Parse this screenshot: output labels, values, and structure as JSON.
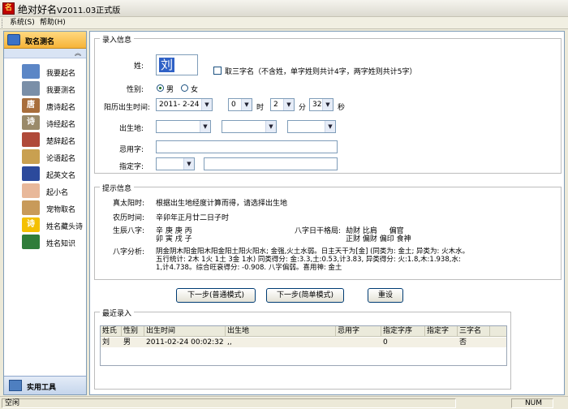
{
  "window": {
    "title": "绝对好名",
    "version": "V2011.03正式版",
    "icon_glyph": "名"
  },
  "menu": {
    "system": "系统(S)",
    "help": "帮助(H)"
  },
  "sidebar": {
    "header": "取名测名",
    "items": [
      {
        "label": "我要起名",
        "icon": "person-icon",
        "color": "#5b86c6"
      },
      {
        "label": "我要测名",
        "icon": "magnifier-icon",
        "color": "#7a8fa8"
      },
      {
        "label": "唐诗起名",
        "icon": "tang-poem-icon",
        "color": "#a86e3c",
        "glyph": "唐"
      },
      {
        "label": "诗经起名",
        "icon": "book-of-songs-icon",
        "color": "#9a8a6a",
        "glyph": "诗"
      },
      {
        "label": "楚辞起名",
        "icon": "chuci-icon",
        "color": "#b04a3a"
      },
      {
        "label": "论语起名",
        "icon": "analects-icon",
        "color": "#c9a050"
      },
      {
        "label": "起英文名",
        "icon": "uk-flag-icon",
        "color": "#2c4a9c"
      },
      {
        "label": "起小名",
        "icon": "baby-icon",
        "color": "#e8b89a"
      },
      {
        "label": "宠物取名",
        "icon": "dog-icon",
        "color": "#c89a5a"
      },
      {
        "label": "姓名藏头诗",
        "icon": "poem-icon",
        "color": "#f4c000",
        "glyph": "诗"
      },
      {
        "label": "姓名知识",
        "icon": "globe-icon",
        "color": "#2f7d3a"
      }
    ],
    "footer": "实用工具"
  },
  "input_section": {
    "legend": "录入信息",
    "surname_label": "姓:",
    "surname_value": "刘",
    "three_char_label": "取三字名（不含姓，单字姓则共计4字，两字姓则共计5字）",
    "gender_label": "性别:",
    "gender_male": "男",
    "gender_female": "女",
    "birth_label": "阳历出生时间:",
    "birth_date": "2011- 2-24",
    "birth_hour": "0",
    "hour_unit": "时",
    "birth_minute": "2",
    "minute_unit": "分",
    "birth_second": "32",
    "second_unit": "秒",
    "birthplace_label": "出生地:",
    "avoid_label": "忌用字:",
    "assign_label": "指定字:"
  },
  "hint_section": {
    "legend": "提示信息",
    "solar_time_label": "真太阳时:",
    "solar_time_value": "根据出生地经度计算而得，请选择出生地",
    "lunar_label": "农历时间:",
    "lunar_value": "辛卯年正月廿二日子时",
    "bazi_label": "生辰八字:",
    "bazi_row1": "辛 庚 庚 丙",
    "bazi_row2": "卯 寅 戌 子",
    "pattern_label": "八字日干格局:",
    "pattern_row1": "劫财 比肩 　 偏官",
    "pattern_row2": "正财 偏财 偏印 食神",
    "analysis_label": "八字分析:",
    "analysis_line1": "阴金阴木阳金阳木阳金阳土阳火阳水; 金强,火土水弱。日主天干为[金] (同类为: 金土; 异类为: 火木水。",
    "analysis_line2": "五行统计: 2木 1火 1土 3金 1水) 同类得分: 金:3.3,土:0.53,计3.83, 异类得分: 火:1.8,木:1.938,水:",
    "analysis_line3": "1,计4.738。综合旺衰得分: -0.908. 八字偏弱。喜用神: 金土"
  },
  "buttons": {
    "next_normal": "下一步(普通模式)",
    "next_simple": "下一步(简单模式)",
    "reset": "重设"
  },
  "recent": {
    "legend": "最近录入",
    "columns": [
      "姓氏",
      "性别",
      "出生时间",
      "出生地",
      "忌用字",
      "指定字序",
      "指定字",
      "三字名"
    ],
    "rows": [
      [
        "刘",
        "男",
        "2011-02-24 00:02:32",
        ",,",
        "",
        "0",
        "",
        "否"
      ]
    ]
  },
  "status": {
    "left": "空闲",
    "num": "NUM"
  }
}
